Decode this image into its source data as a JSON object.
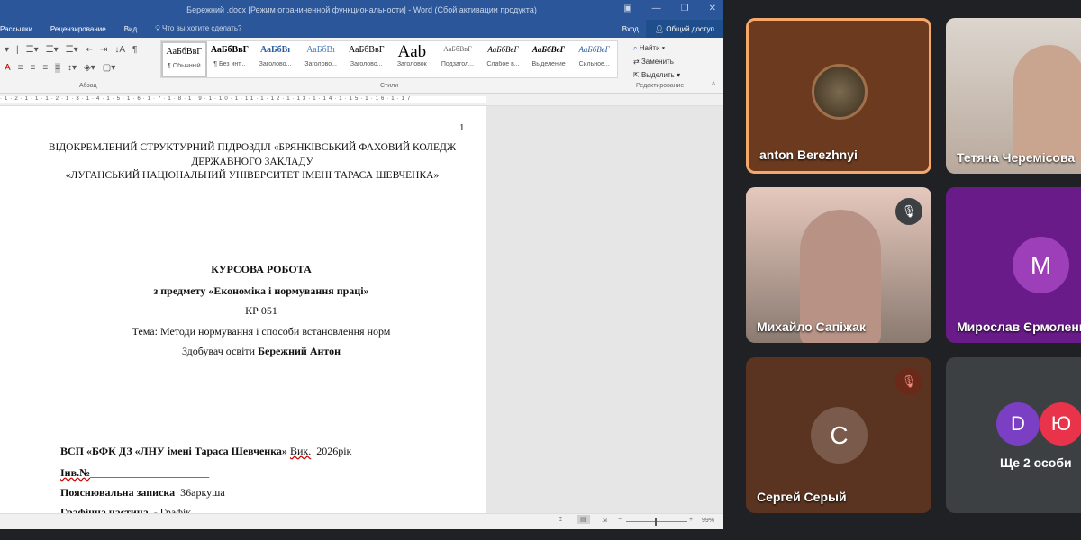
{
  "word": {
    "title": "Бережний .docx [Режим ограниченной функциональности] - Word (Сбой активации продукта)",
    "tabs": [
      "Рассылки",
      "Рецензирование",
      "Вид"
    ],
    "tell_me": "Что вы хотите сделать?",
    "signin": "Вход",
    "share": "Общий доступ",
    "group_paragraph": "Абзац",
    "group_styles": "Стили",
    "group_editing": "Редактирование",
    "styles": [
      {
        "sample": "АаБбВвГ",
        "name": "¶ Обычный"
      },
      {
        "sample": "АаБбВвГ",
        "name": "¶ Без инт..."
      },
      {
        "sample": "АаБбВı",
        "name": "Заголово..."
      },
      {
        "sample": "АаБбВı",
        "name": "Заголово..."
      },
      {
        "sample": "АаБбВвГ",
        "name": "Заголово..."
      },
      {
        "sample": "Aab",
        "name": "Заголовок"
      },
      {
        "sample": "АаБбВвГ",
        "name": "Подзагол..."
      },
      {
        "sample": "АаБбВвГ",
        "name": "Слабое в..."
      },
      {
        "sample": "АаБбВвГ",
        "name": "Выделение"
      },
      {
        "sample": "АаБбВвГ",
        "name": "Сильное..."
      }
    ],
    "find": "Найти",
    "replace": "Заменить",
    "select": "Выделить",
    "zoom": "99%"
  },
  "doc": {
    "page_number": "1",
    "header1": "ВІДОКРЕМЛЕНИЙ СТРУКТУРНИЙ ПІДРОЗДІЛ  «БРЯНКІВСЬКИЙ ФАХОВИЙ КОЛЕДЖ",
    "header2": "ДЕРЖАВНОГО ЗАКЛАДУ",
    "header3": "«ЛУГАНСЬКИЙ НАЦІОНАЛЬНИЙ УНІВЕРСИТЕТ ІМЕНІ ТАРАСА ШЕВЧЕНКА»",
    "title": "КУРСОВА РОБОТА",
    "subject": "з предмету «Економіка і нормування праці»",
    "code": "КР 051",
    "topic": "Тема: Методи нормування і способи встановлення норм",
    "student_label": "Здобувач освіти",
    "student_name": "Бережний Антон",
    "org_line": "ВСП «БФК ДЗ «ЛНУ імені Тараса Шевченка»",
    "vik": "Вик.",
    "year": "2026рік",
    "inv": "Інв.№",
    "note_label": "Пояснювальна записка",
    "note_value": "36аркуша",
    "graph_label": "Графічна частина",
    "graph_value": "- Графік"
  },
  "meet": {
    "participants": [
      {
        "name": "anton Berezhnyi"
      },
      {
        "name": "Тетяна Черемісова"
      },
      {
        "name": "Михайло Сапіжак"
      },
      {
        "name": "Мирослав Єрмоленко",
        "initial": "M"
      },
      {
        "name": "Сергей Серый",
        "initial": "C"
      }
    ],
    "more_label": "Ще 2 особи",
    "more_initials": [
      "D",
      "Ю"
    ],
    "colors": {
      "speaking_border": "#f5a86a",
      "purple": "#6a1b8a",
      "brown": "#5a3420"
    }
  }
}
